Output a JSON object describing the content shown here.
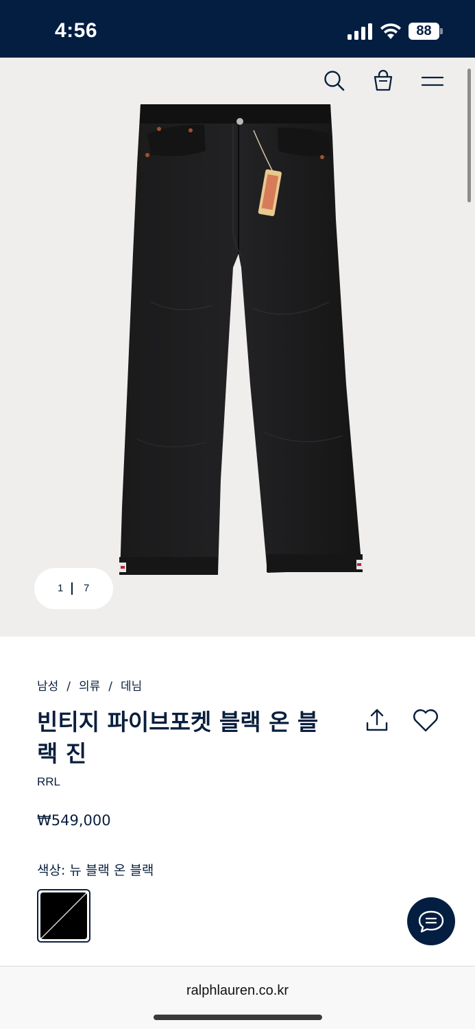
{
  "status": {
    "time": "4:56",
    "battery": "88",
    "icons": [
      "signal-icon",
      "wifi-icon",
      "battery-icon"
    ]
  },
  "header": {
    "icons": [
      "search-icon",
      "shopping-bag-icon",
      "menu-icon"
    ]
  },
  "gallery": {
    "current": "1",
    "total": "7",
    "progress": 0.1429,
    "background": "#efeeec"
  },
  "breadcrumb": [
    "남성",
    "의류",
    "데님"
  ],
  "product": {
    "title": "빈티지 파이브포켓 블랙 온 블랙 진",
    "brand": "RRL",
    "price": "₩549,000",
    "color_label": "색상: 뉴 블랙 온 블랙",
    "action_icons": [
      "share-icon",
      "heart-icon"
    ]
  },
  "chat": {
    "icon": "chat-bubble-icon"
  },
  "browser": {
    "url": "ralphlauren.co.kr"
  },
  "colors": {
    "navy": "#041e42",
    "text": "#0a1f3d"
  }
}
